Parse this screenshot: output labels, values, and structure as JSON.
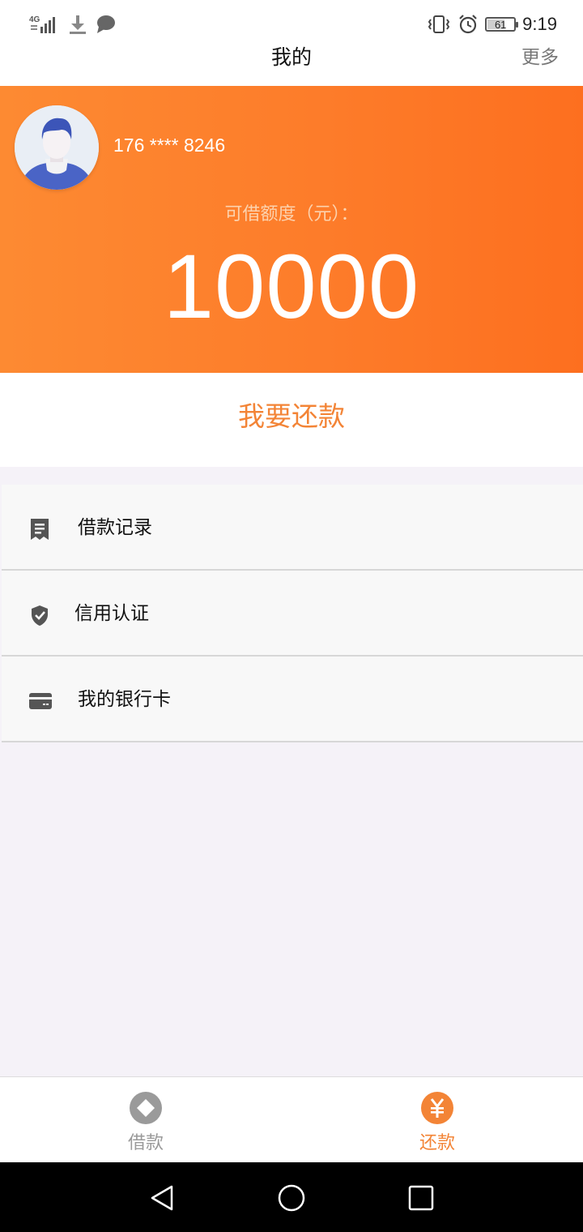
{
  "status_bar": {
    "network": "4G",
    "battery": "61",
    "time": "9:19",
    "icons": [
      "signal-icon",
      "download-icon",
      "message-icon",
      "vibrate-icon",
      "alarm-icon",
      "battery-icon"
    ]
  },
  "header": {
    "title": "我的",
    "more_label": "更多"
  },
  "profile": {
    "phone": "176 **** 8246",
    "credit_label": "可借额度（元）：",
    "credit_amount": "10000",
    "avatar_icon": "user-avatar-icon"
  },
  "repay": {
    "label": "我要还款"
  },
  "menu": {
    "items": [
      {
        "label": "借款记录",
        "icon": "receipt-icon"
      },
      {
        "label": "信用认证",
        "icon": "shield-check-icon"
      },
      {
        "label": "我的银行卡",
        "icon": "bank-card-icon"
      }
    ]
  },
  "tabbar": {
    "tabs": [
      {
        "label": "借款",
        "icon": "diamond-icon",
        "active": false
      },
      {
        "label": "还款",
        "icon": "yen-icon",
        "active": true
      }
    ]
  },
  "colors": {
    "accent": "#f38436",
    "hero_start": "#fd8a32",
    "hero_end": "#fd6f1f",
    "tab_inactive": "#9a9a9a",
    "icon_gray": "#555555"
  },
  "system_nav": {
    "icons": [
      "back-icon",
      "home-icon",
      "recents-icon"
    ]
  }
}
